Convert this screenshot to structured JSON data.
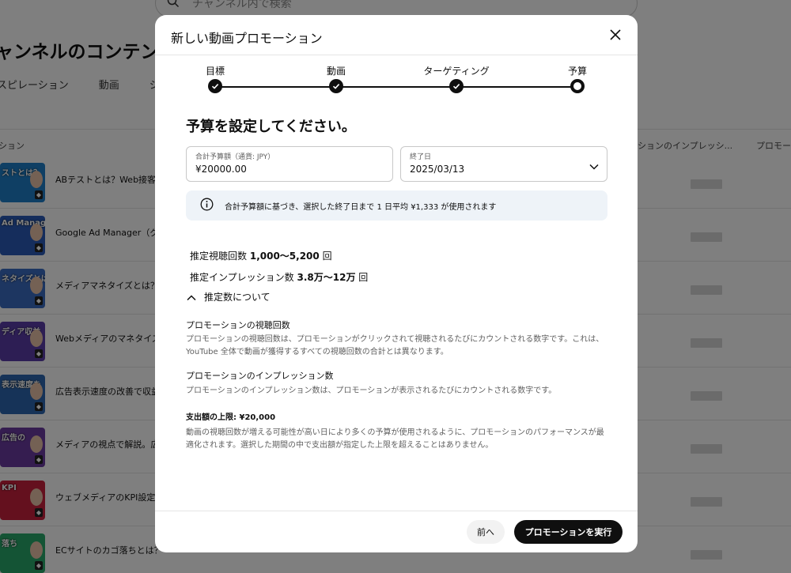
{
  "background": {
    "search_placeholder": "チャンネル内で検索",
    "page_title": "ャンネルのコンテンツ",
    "tabs": [
      "スピレーション",
      "動画",
      "ショ"
    ],
    "col_left": "ション",
    "col_right1": "ションのインプレッシ...",
    "col_right2": "プロモーシ",
    "rows": [
      {
        "title": "ABテストとは？Web接客に",
        "thumb_text": "ストとは？",
        "thumb_color": "#1e7fc9"
      },
      {
        "title": "Google Ad Manager（グー",
        "thumb_text": "Ad Manager",
        "thumb_color": "#2a5bb8"
      },
      {
        "title": "メディアマネタイズとは？",
        "thumb_text": "ネタイズとは？",
        "thumb_color": "#3b6cc2"
      },
      {
        "title": "Webメディアのマネタイズ",
        "thumb_text": "ディア収益",
        "thumb_color": "#5a3da8"
      },
      {
        "title": "広告表示速度の改善で収益",
        "thumb_text": "表示速度を",
        "thumb_color": "#2d67b0"
      },
      {
        "title": "メディアの視点で解説。広告",
        "thumb_text": "広告の",
        "thumb_color": "#6a3aa0"
      },
      {
        "title": "ウェブメディアのKPI設定。",
        "thumb_text": "KPI",
        "thumb_color": "#c8203c"
      },
      {
        "title": "ECサイトのカゴ落ちとは？",
        "thumb_text": "落ち",
        "thumb_color": "#29a86a"
      }
    ]
  },
  "modal": {
    "title": "新しい動画プロモーション",
    "steps": [
      {
        "label": "目標",
        "state": "done"
      },
      {
        "label": "動画",
        "state": "done"
      },
      {
        "label": "ターゲティング",
        "state": "done"
      },
      {
        "label": "予算",
        "state": "current"
      }
    ],
    "heading": "予算を設定してください。",
    "budget": {
      "label": "合計予算額（通貨: JPY）",
      "value": "¥20000.00"
    },
    "end_date": {
      "label": "終了日",
      "value": "2025/03/13"
    },
    "info_text": "合計予算額に基づき、選択した終了日まで 1 日平均 ¥1,333 が使用されます",
    "views": {
      "label": "推定視聴回数",
      "value": "1,000～5,200",
      "unit": "回"
    },
    "impressions": {
      "label": "推定インプレッション数",
      "value": "3.8万～12万",
      "unit": "回"
    },
    "toggle_label": "推定数について",
    "sections": [
      {
        "heading": "プロモーションの視聴回数",
        "text": "プロモーションの視聴回数は、プロモーションがクリックされて視聴されるたびにカウントされる数字です。これは、YouTube 全体で動画が獲得するすべての視聴回数の合計とは異なります。"
      },
      {
        "heading": "プロモーションのインプレッション数",
        "text": "プロモーションのインプレッション数は、プロモーションが表示されるたびにカウントされる数字です。"
      },
      {
        "heading": "支出額の上限: ¥20,000",
        "text": "動画の視聴回数が増える可能性が高い日により多くの予算が使用されるように、プロモーションのパフォーマンスが最適化されます。選択した期間の中で支出額が指定した上限を超えることはありません。"
      }
    ],
    "prev_label": "前へ",
    "run_label": "プロモーションを実行"
  }
}
